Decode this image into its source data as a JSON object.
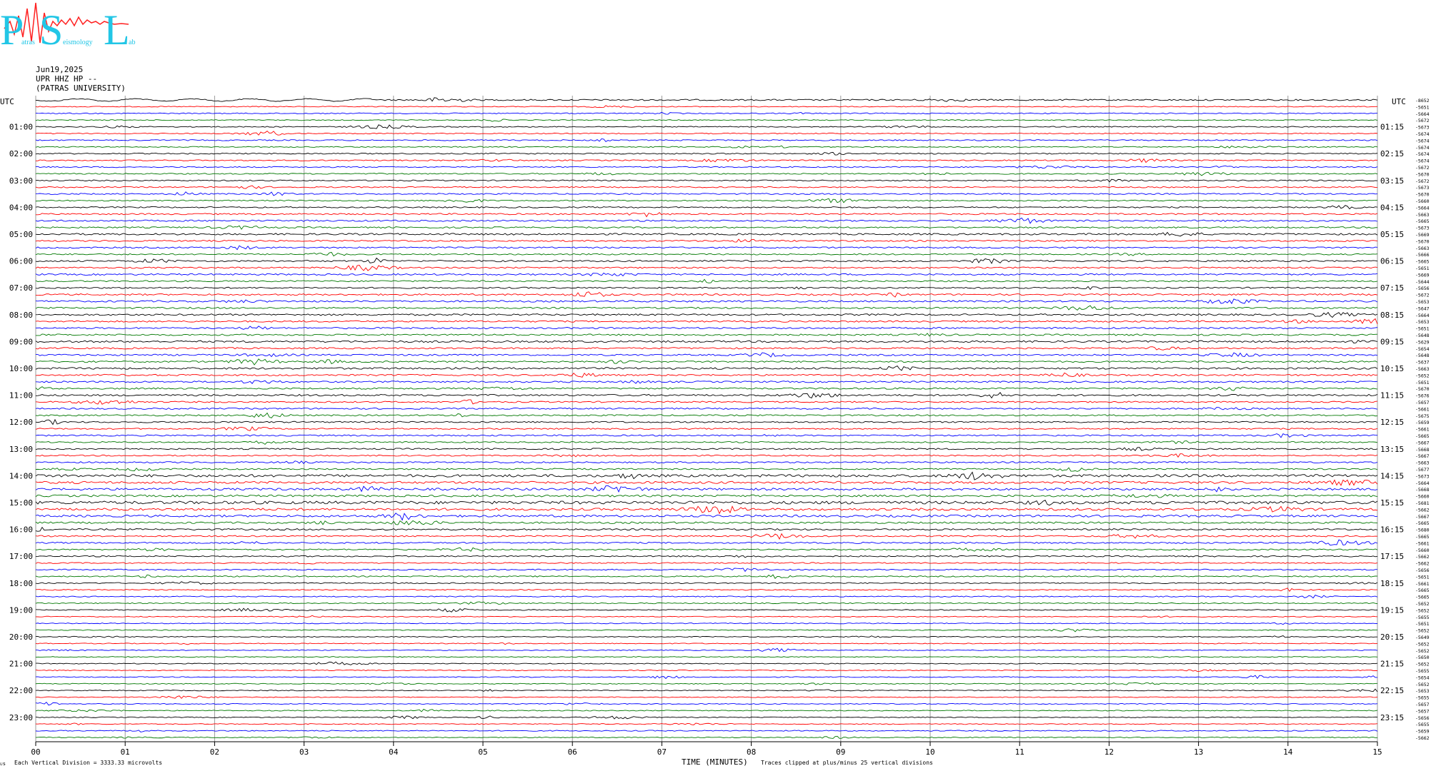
{
  "logo": {
    "big_letters": [
      "P",
      "S",
      "L"
    ],
    "small_words": [
      "atras",
      "eismology",
      "ab"
    ]
  },
  "header": {
    "date": "Jun19,2025",
    "station": "UPR HHZ HP --",
    "institution": "(PATRAS UNIVERSITY)"
  },
  "chart_data": {
    "type": "line",
    "title": "",
    "left_axis_title": "UTC",
    "right_axis_title": "UTC",
    "left_time_labels": [
      "01:00",
      "02:00",
      "03:00",
      "04:00",
      "05:00",
      "06:00",
      "07:00",
      "08:00",
      "09:00",
      "10:00",
      "11:00",
      "12:00",
      "13:00",
      "14:00",
      "15:00",
      "16:00",
      "17:00",
      "18:00",
      "19:00",
      "20:00",
      "21:00",
      "22:00",
      "23:00"
    ],
    "right_time_labels": [
      "01:15",
      "02:15",
      "03:15",
      "04:15",
      "05:15",
      "06:15",
      "07:15",
      "08:15",
      "09:15",
      "10:15",
      "11:15",
      "12:15",
      "13:15",
      "14:15",
      "15:15",
      "16:15",
      "17:15",
      "18:15",
      "19:15",
      "20:15",
      "21:15",
      "22:15",
      "23:15"
    ],
    "x_ticks": [
      "00",
      "01",
      "02",
      "03",
      "04",
      "05",
      "06",
      "07",
      "08",
      "09",
      "10",
      "11",
      "12",
      "13",
      "14",
      "15"
    ],
    "xlabel": "TIME (MINUTES)",
    "xlim": [
      0,
      15
    ],
    "trace_colors": [
      "#000000",
      "#ff0000",
      "#0000ff",
      "#007700"
    ],
    "trace_count": 96,
    "row_values": [
      "-8652",
      "-5651",
      "-5664",
      "-5672",
      "-5673",
      "-5674",
      "-5674",
      "-5674",
      "-5674",
      "-5674",
      "-5672",
      "-5670",
      "-5672",
      "-5673",
      "-5670",
      "-5660",
      "-5664",
      "-5663",
      "-5665",
      "-5673",
      "-5669",
      "-5670",
      "-5663",
      "-5666",
      "-5665",
      "-5651",
      "-5669",
      "-5644",
      "-5656",
      "-5672",
      "-5653",
      "-5647",
      "-5664",
      "-5653",
      "-5651",
      "-5648",
      "-5629",
      "-5654",
      "-5648",
      "-5637",
      "-5663",
      "-5652",
      "-5651",
      "-5670",
      "-5676",
      "-5657",
      "-5661",
      "-5675",
      "-5659",
      "-5661",
      "-5665",
      "-5667",
      "-5668",
      "-5667",
      "-5663",
      "-5677",
      "-5673",
      "-5664",
      "-5668",
      "-5660",
      "-5681",
      "-5662",
      "-5667",
      "-5665",
      "-5680",
      "-5665",
      "-5661",
      "-5660",
      "-5662",
      "-5662",
      "-5656",
      "-5651",
      "-5661",
      "-5665",
      "-5665",
      "-5652",
      "-5652",
      "-5655",
      "-5651",
      "-5652",
      "-5649",
      "-5652",
      "-5652",
      "-5650",
      "-5652",
      "-5655",
      "-5654",
      "-5652",
      "-5653",
      "-5655",
      "-5657",
      "-5657",
      "-5656",
      "-5655",
      "-5659",
      "-5662"
    ],
    "activity": [
      0.5,
      0.3,
      0.35,
      0.3,
      0.35,
      0.35,
      0.4,
      0.35,
      0.4,
      0.4,
      0.4,
      0.4,
      0.4,
      0.4,
      0.45,
      0.4,
      0.45,
      0.5,
      0.55,
      0.5,
      0.6,
      0.5,
      0.5,
      0.45,
      0.55,
      0.5,
      0.55,
      0.5,
      0.5,
      0.55,
      0.6,
      0.55,
      0.6,
      0.55,
      0.55,
      0.55,
      0.65,
      0.55,
      0.55,
      0.55,
      0.65,
      0.55,
      0.55,
      0.55,
      0.6,
      0.5,
      0.5,
      0.5,
      0.5,
      0.45,
      0.5,
      0.45,
      0.5,
      0.45,
      0.5,
      0.5,
      0.9,
      0.8,
      0.75,
      0.7,
      1.0,
      0.8,
      0.75,
      0.6,
      0.55,
      0.5,
      0.5,
      0.45,
      0.45,
      0.4,
      0.4,
      0.4,
      0.4,
      0.35,
      0.35,
      0.35,
      0.35,
      0.3,
      0.3,
      0.3,
      0.3,
      0.3,
      0.3,
      0.3,
      0.3,
      0.3,
      0.3,
      0.3,
      0.3,
      0.3,
      0.3,
      0.3,
      0.3,
      0.3,
      0.35,
      0.3
    ]
  },
  "footer": {
    "left_marker": "ᴜs",
    "division_note": "Each Vertical Division = 3333.33 microvolts",
    "clip_note": "Traces clipped at plus/minus 25 vertical divisions"
  }
}
